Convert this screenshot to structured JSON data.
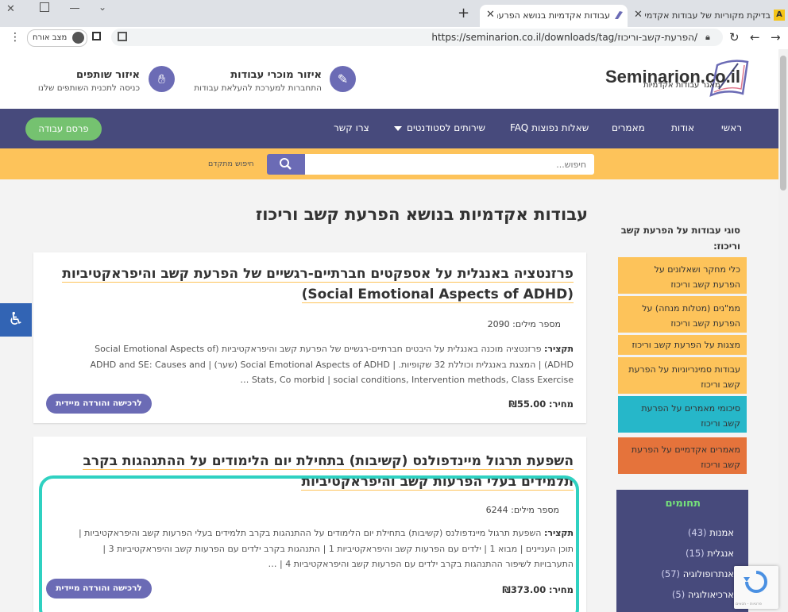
{
  "browser": {
    "tabs": [
      {
        "title": "בדיקת מקוריות של עבודות אקדמי",
        "favicon": "A"
      },
      {
        "title": "עבודות אקדמיות בנושא הפרעת ק"
      }
    ],
    "url": "https://seminarion.co.il/downloads/tag/הפרעת-קשב-וריכוז/",
    "profile_label": "מצב אורח"
  },
  "header": {
    "logo": "Seminarion.co.il",
    "logo_tagline": "מאגר עבודות אקדמיות",
    "sellers_title": "איזור מוכרי עבודות",
    "sellers_sub": "התחברות למערכת להעלאת עבודות",
    "partners_title": "איזור שותפים",
    "partners_sub": "כניסה לתכנית השותפים שלנו"
  },
  "nav": {
    "home": "ראשי",
    "about": "אודות",
    "articles": "מאמרים",
    "faq": "שאלות נפוצות FAQ",
    "services": "שירותים לסטודנטים",
    "contact": "צרו קשר",
    "publish": "פרסם עבודה"
  },
  "search": {
    "placeholder": "חיפוש...",
    "advanced": "חיפוש מתקדם"
  },
  "page_title": "עבודות אקדמיות בנושא הפרעת קשב וריכוז",
  "sidebar": {
    "title": "סוגי עבודות על הפרעת קשב וריכוז:",
    "items": [
      "כלי מחקר ושאלונים על הפרעת קשב וריכוז",
      "ממ\"נים (מטלות מנחה) על הפרעת קשב וריכוז",
      "מצגות על הפרעת קשב וריכוז",
      "עבודות סמינריוניות על הפרעת קשב וריכוז",
      "סיכומי מאמרים על הפרעת קשב וריכוז",
      "מאמרים אקדמיים על הפרעת קשב וריכוז"
    ],
    "fields_title": "תחומים",
    "fields": [
      {
        "name": "אמנות",
        "count": "(43)"
      },
      {
        "name": "אנגלית",
        "count": "(15)"
      },
      {
        "name": "אנתרופולוגיה",
        "count": "(57)"
      },
      {
        "name": "ארכיאולוגיה",
        "count": "(5)"
      }
    ]
  },
  "cards": [
    {
      "title": "פרזנטציה באנגלית על אספקטים חברתיים-רגשיים של הפרעת קשב והיפראקטיביות (Social Emotional Aspects of ADHD)",
      "words": "מספר מילים: 2090",
      "summary_label": "תקציר:",
      "summary": "פרזנטציה מוכנה באנגלית על היבטים חברתיים-רגשיים של הפרעת קשב והיפראקטיביות (Social Emotional Aspects of ADHD) | המצגת באנגלית וכוללת 32 שקופיות. | Social Emotional Aspects of ADHD (שער) | ADHD and SE: Causes and Stats, Co morbid | social conditions, Intervention methods, Class Exercise …",
      "price_label": "מחיר:",
      "price": "₪55.00",
      "button": "לרכישה והורדה מיידית"
    },
    {
      "title": "השפעת תרגול מיינדפולנס (קשיבות) בתחילת יום הלימודים על ההתנהגות בקרב תלמידים בעלי הפרעות קשב והיפראקטיביות",
      "words": "מספר מילים: 6244",
      "summary_label": "תקציר:",
      "summary": "השפעת תרגול מיינדפולנס (קשיבות) בתחילת יום הלימודים על ההתנהגות בקרב תלמידים בעלי הפרעות קשב והיפראקטיביות | תוכן העניינים | מבוא 1 | ילדים עם הפרעות קשב והיפראקטיביות 1 | התנהגות בקרב ילדים עם הפרעות קשב והיפראקטיביות 3 | התערבויות לשיפור ההתנהגות בקרב ילדים עם הפרעות קשב והיפראקטיביות 4 | …",
      "price_label": "מחיר:",
      "price": "₪373.00",
      "button": "לרכישה והורדה מיידית"
    }
  ],
  "recaptcha_label": "פרטיות - תנאים",
  "colors": {
    "nav": "#474a7c",
    "accent": "#fdc35a",
    "button": "#6b6bb5",
    "publish": "#75c270",
    "highlight": "#2fd1c1"
  }
}
